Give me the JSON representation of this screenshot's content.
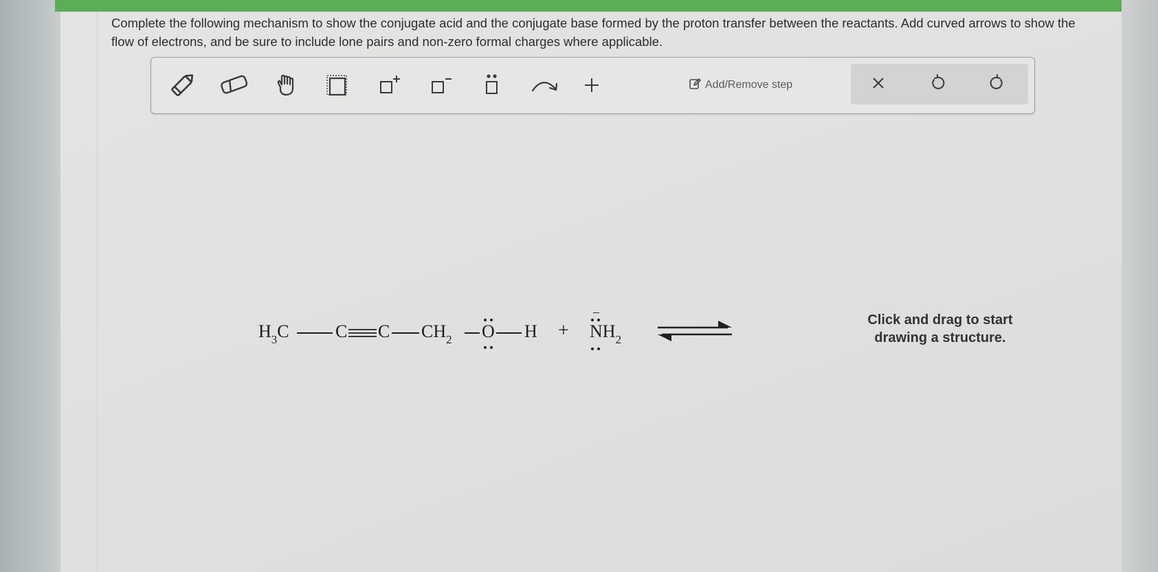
{
  "question": {
    "text": "Complete the following mechanism to show the conjugate acid and the conjugate base formed by the proton transfer between the reactants. Add curved arrows to show the flow of electrons, and be sure to include lone pairs and non-zero formal charges where applicable."
  },
  "toolbar": {
    "tools": [
      "pencil-icon",
      "eraser-icon",
      "hand-icon",
      "selection-box-icon",
      "positive-charge-icon",
      "negative-charge-icon",
      "lone-pair-icon",
      "curved-arrow-icon",
      "plus-icon"
    ],
    "add_remove_step_label": "Add/Remove step",
    "actions": [
      "close-icon",
      "undo-icon",
      "redo-icon"
    ]
  },
  "reaction": {
    "h3c_h": "H",
    "h3c_sub": "3",
    "h3c_c": "C",
    "c2": "C",
    "c3": "C",
    "ch2_ch": "CH",
    "ch2_sub": "2",
    "o": "O",
    "h": "H",
    "plus": "+",
    "nh2_nh": "NH",
    "nh2_sub": "2",
    "minus": "–"
  },
  "canvas": {
    "hint": "Click and drag to start drawing a structure."
  },
  "colors": {
    "topbar": "#5cac58",
    "page": "#e2e2e0",
    "text": "#2d2d2d"
  }
}
